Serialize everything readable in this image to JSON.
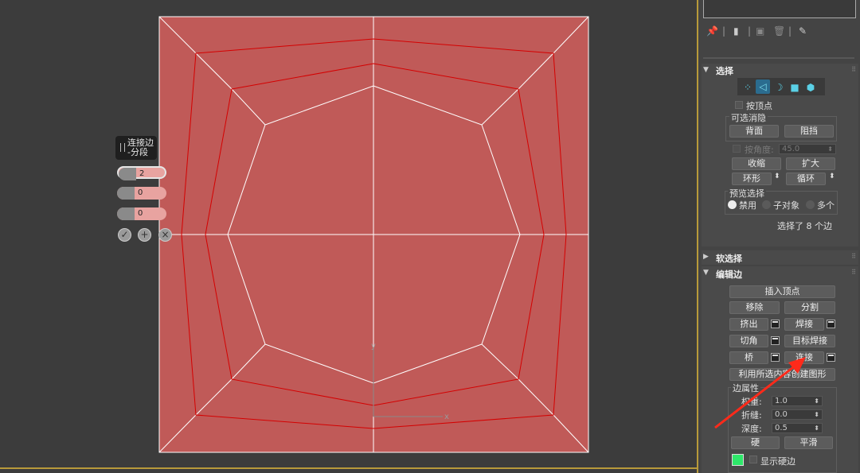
{
  "caddy": {
    "title_line1": "连接边",
    "title_line2": "-分段",
    "segments": "2",
    "pinch": "0",
    "slide": "0",
    "ok_icon": "check-icon",
    "apply_icon": "plus-icon",
    "cancel_icon": "x-icon"
  },
  "viewport": {
    "axis_y": "y",
    "axis_x": "x",
    "colors": {
      "plane": "#c05a58",
      "edges": "#ffffff",
      "selected_edges": "#d40000",
      "background": "#3c3c3c",
      "arrow": "#ff2a1a"
    }
  },
  "panel": {
    "selection": {
      "title": "选择",
      "by_vertex": "按顶点",
      "ignore_group": "可选消隐",
      "backface": "背面",
      "occluded": "阻挡",
      "by_angle": "按角度:",
      "angle_value": "45.0",
      "shrink": "收缩",
      "grow": "扩大",
      "ring": "环形",
      "loop": "循环",
      "preview_group": "预览选择",
      "preview_off": "禁用",
      "preview_sub": "子对象",
      "preview_multi": "多个",
      "status": "选择了 8 个边"
    },
    "soft_selection": {
      "title": "软选择"
    },
    "edit_edges": {
      "title": "编辑边",
      "insert_vertex": "插入顶点",
      "remove": "移除",
      "split": "分割",
      "extrude": "挤出",
      "weld": "焊接",
      "chamfer": "切角",
      "target_weld": "目标焊接",
      "bridge": "桥",
      "connect": "连接",
      "create_shape": "利用所选内容创建图形",
      "edge_props": "边属性",
      "weight_label": "权重:",
      "weight": "1.0",
      "crease_label": "折缝:",
      "crease": "0.0",
      "depth_label": "深度:",
      "depth": "0.5",
      "hard": "硬",
      "smooth": "平滑",
      "show_hard": "显示硬边",
      "hard_color": "#2ee86a"
    }
  }
}
